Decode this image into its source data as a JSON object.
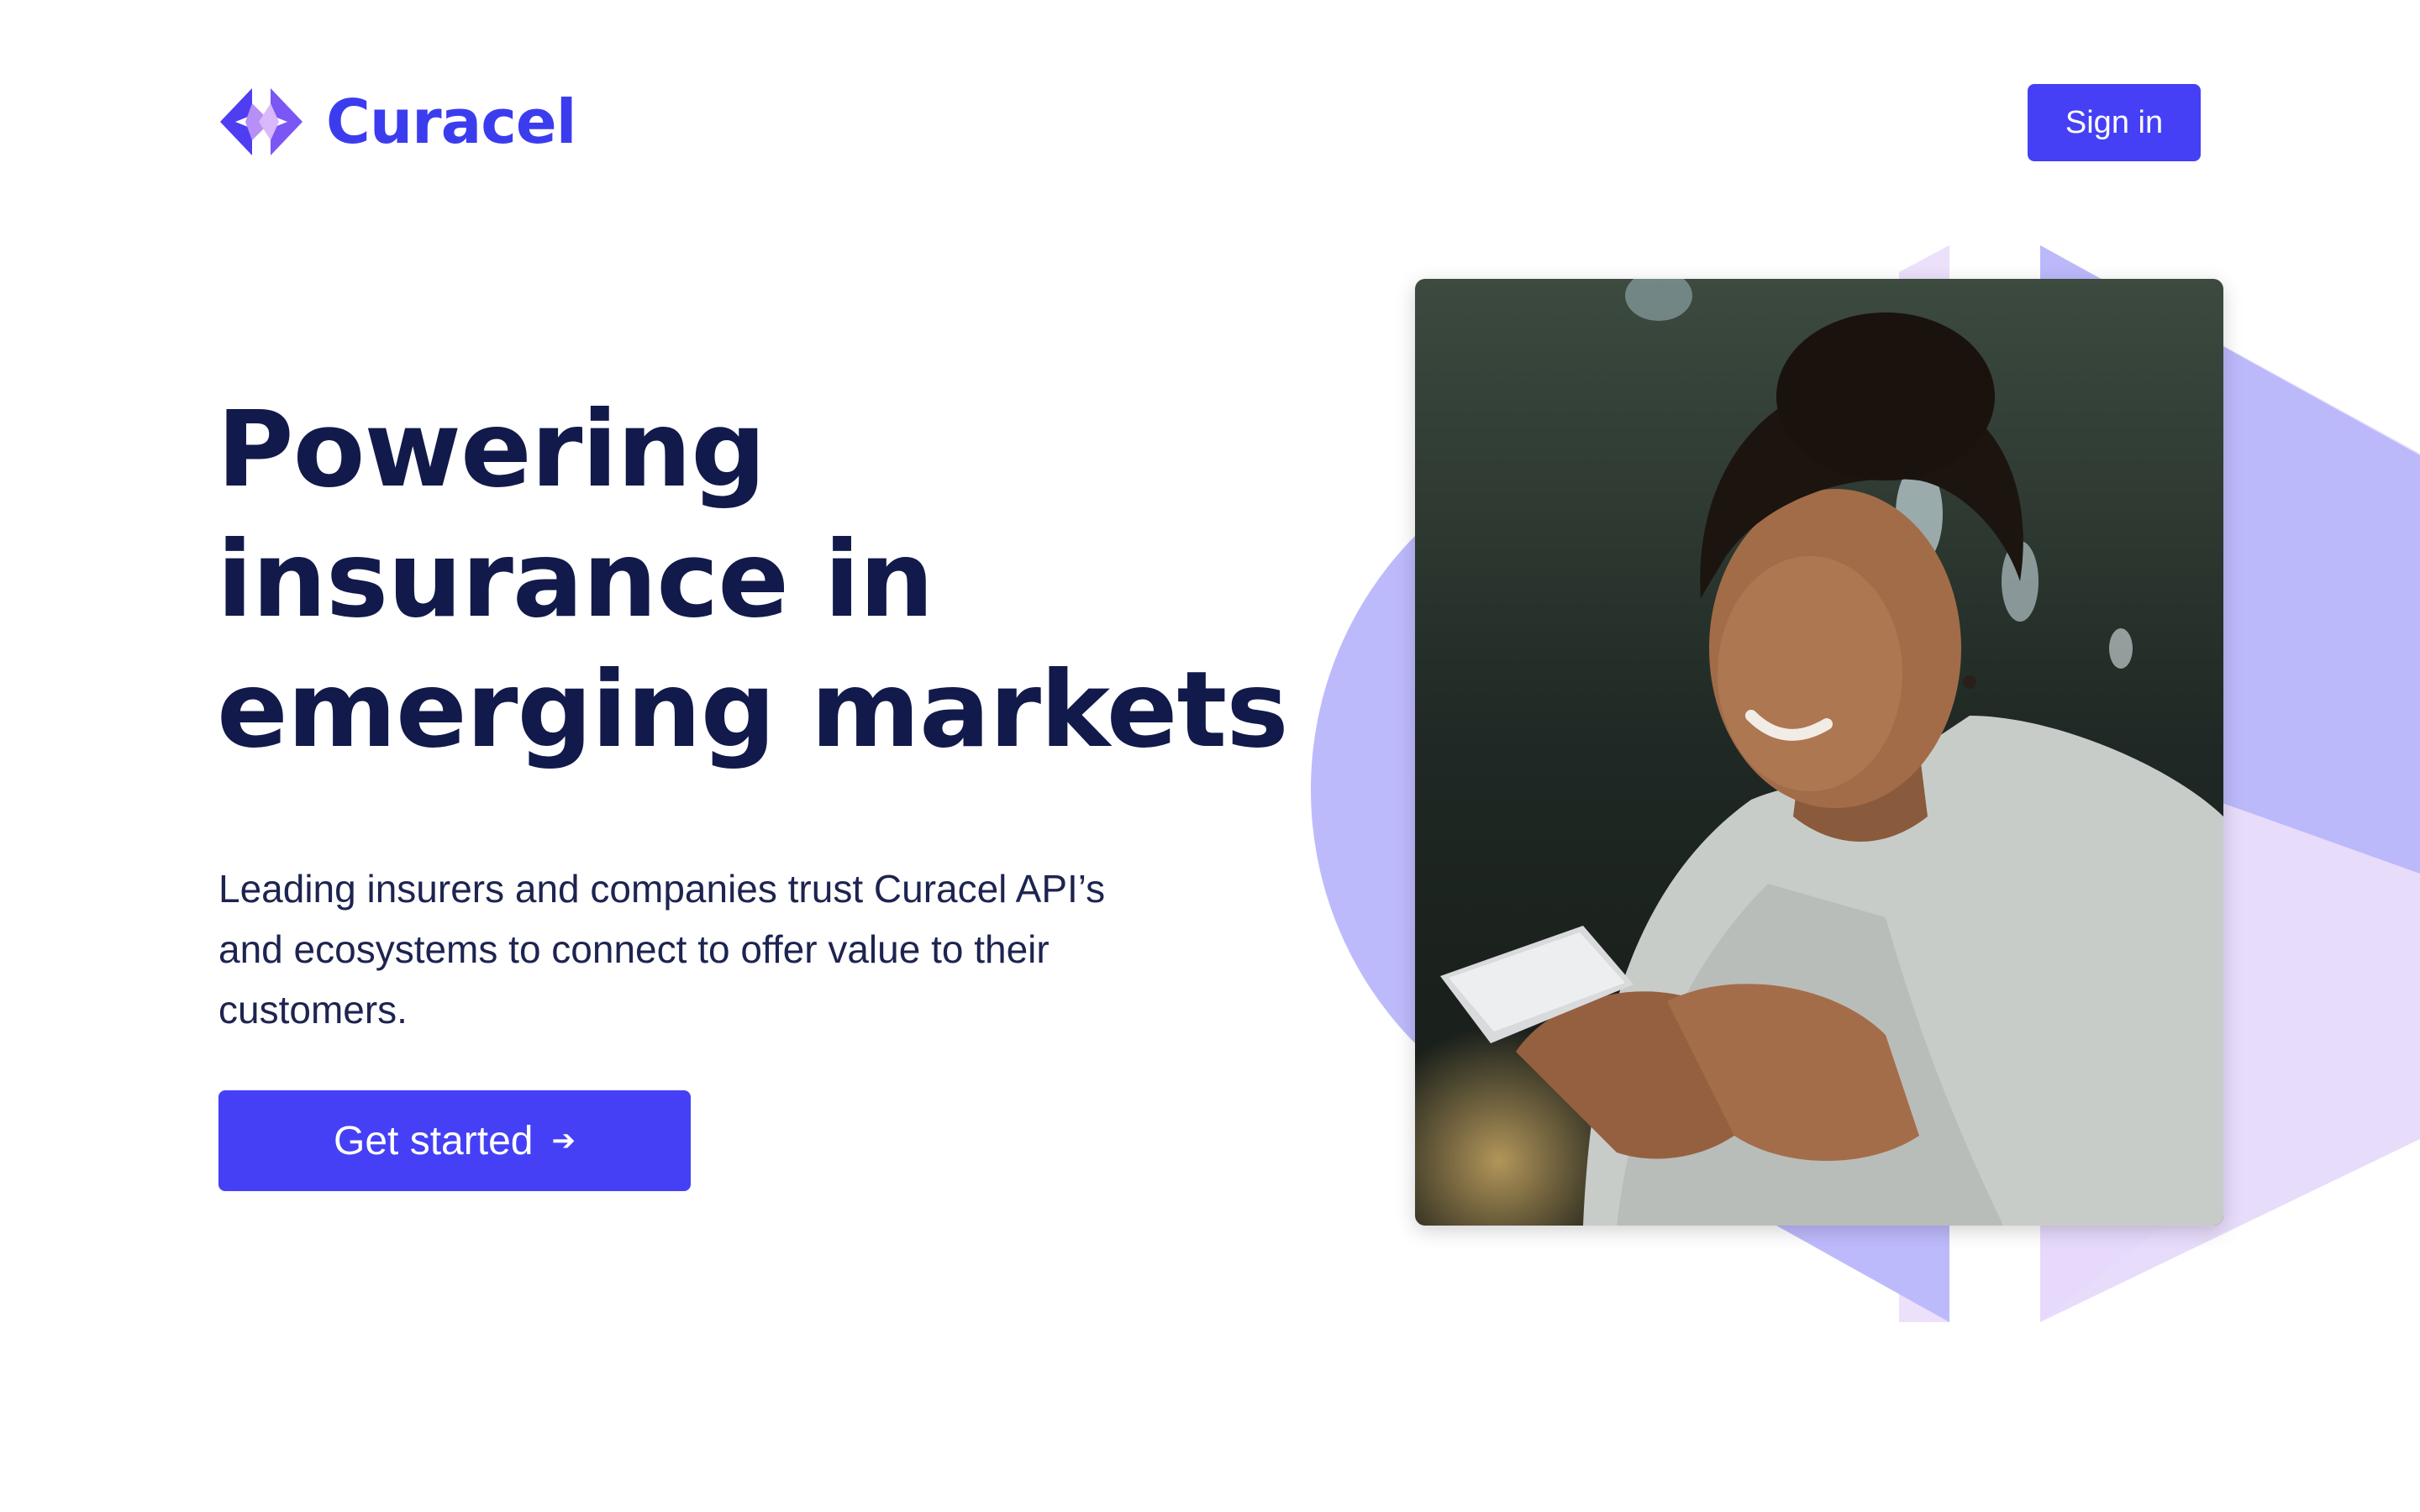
{
  "brand": {
    "name": "Curacel",
    "accent_color": "#3c3cef",
    "logo_icon": "curacel-logo-icon"
  },
  "header": {
    "sign_in_label": "Sign in"
  },
  "hero": {
    "headline_lines": [
      "Powering",
      "insurance in",
      "emerging markets"
    ],
    "subtext": "Leading insurers and companies trust Curacel API’s and ecosystems to connect to offer value to their customers.",
    "cta_label": "Get started",
    "cta_icon": "arrow-right-icon",
    "image_alt": "Smiling woman looking at her smartphone",
    "headline_color": "#111a4a",
    "button_color": "#4540f5",
    "decor_colors": [
      "#bbb9fb",
      "#e6d9fb"
    ]
  }
}
